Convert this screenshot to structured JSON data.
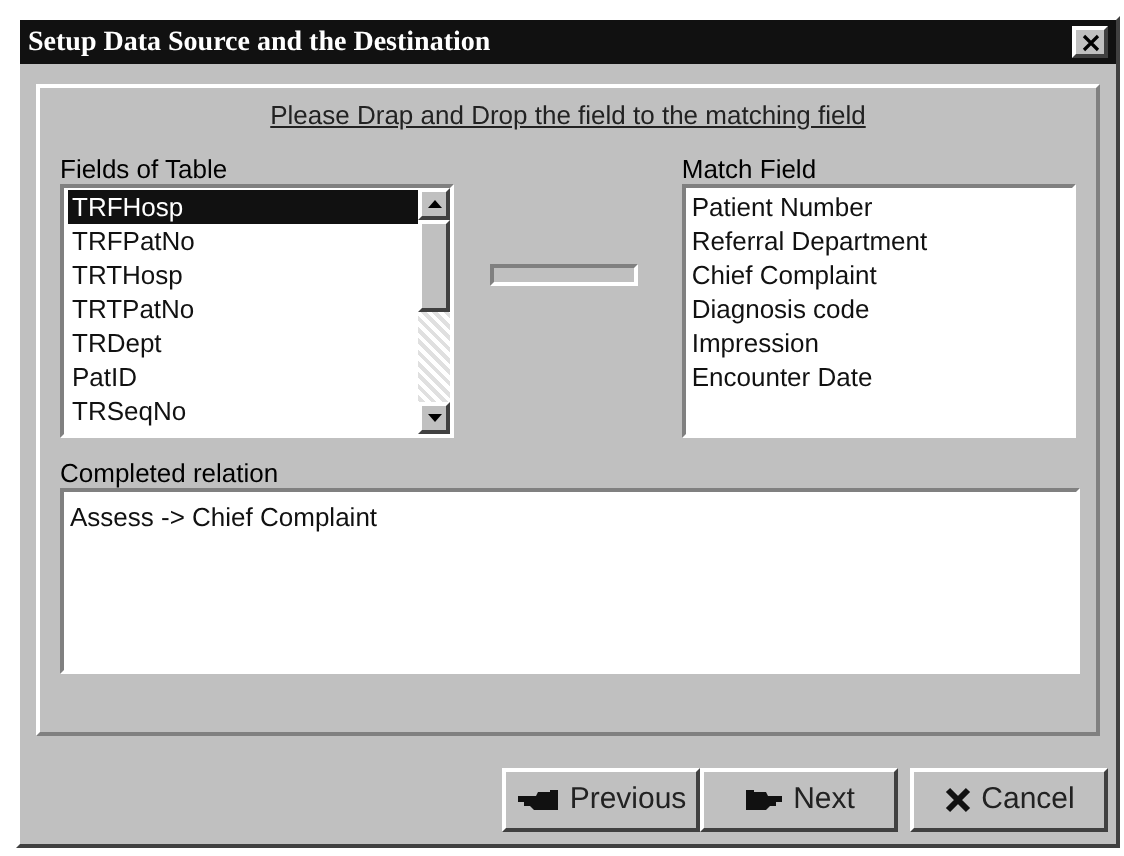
{
  "window": {
    "title": "Setup Data Source and the Destination"
  },
  "instruction": "Please Drap and Drop the field to the matching field",
  "source": {
    "label": "Fields of Table",
    "items": [
      {
        "text": "TRFHosp",
        "selected": true
      },
      {
        "text": "TRFPatNo",
        "selected": false
      },
      {
        "text": "TRTHosp",
        "selected": false
      },
      {
        "text": "TRTPatNo",
        "selected": false
      },
      {
        "text": "TRDept",
        "selected": false
      },
      {
        "text": "PatID",
        "selected": false
      },
      {
        "text": "TRSeqNo",
        "selected": false
      }
    ]
  },
  "match": {
    "label": "Match Field",
    "items": [
      "Patient Number",
      "Referral Department",
      "Chief Complaint",
      "Diagnosis code",
      "Impression",
      "Encounter Date"
    ]
  },
  "relations": {
    "label": "Completed relation",
    "items": [
      "Assess -> Chief Complaint"
    ]
  },
  "buttons": [
    {
      "label": "Previous",
      "kind": "previous"
    },
    {
      "label": "Next",
      "kind": "next"
    },
    {
      "label": "Cancel",
      "kind": "cancel"
    }
  ]
}
